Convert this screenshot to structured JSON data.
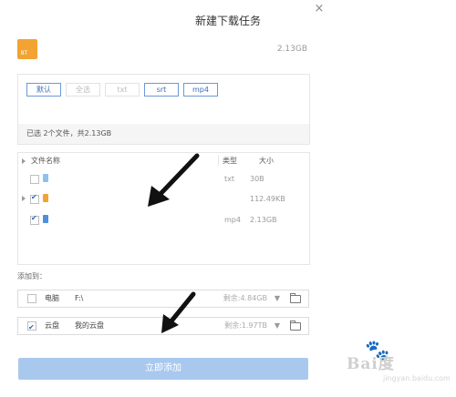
{
  "dialog": {
    "title": "新建下载任务",
    "close_glyph": "×"
  },
  "header": {
    "file_badge": "BT",
    "total_size": "2.13GB"
  },
  "filters": {
    "chips": [
      "默认",
      "全选",
      "txt",
      "srt",
      "mp4"
    ],
    "selected_summary": "已选 2个文件，共2.13GB"
  },
  "file_list": {
    "columns": {
      "name": "文件名称",
      "type": "类型",
      "size": "大小"
    },
    "rows": [
      {
        "type": "txt",
        "size": "30B",
        "checked": false
      },
      {
        "type": "",
        "size": "112.49KB",
        "checked": true
      },
      {
        "type": "mp4",
        "size": "2.13GB",
        "checked": true
      }
    ]
  },
  "add_to": {
    "label": "添加到：",
    "destinations": [
      {
        "label": "电脑",
        "path": "F:\\",
        "free": "剩余:4.84GB",
        "checked": false
      },
      {
        "label": "云盘",
        "path": "我的云盘",
        "free": "剩余:1.97TB",
        "checked": true
      }
    ]
  },
  "submit": {
    "label": "立即添加"
  },
  "watermark": {
    "main": "Bai度",
    "sub": "jingyan.baidu.com"
  },
  "icons": {
    "close": "close-icon",
    "expand": "triangle-right-icon",
    "dropdown": "chevron-down-icon",
    "folder": "folder-icon"
  },
  "colors": {
    "accent": "#3b6fb3",
    "submit": "#a9c8ee",
    "file_orange": "#f2a332",
    "file_blue": "#4f8fdc"
  }
}
